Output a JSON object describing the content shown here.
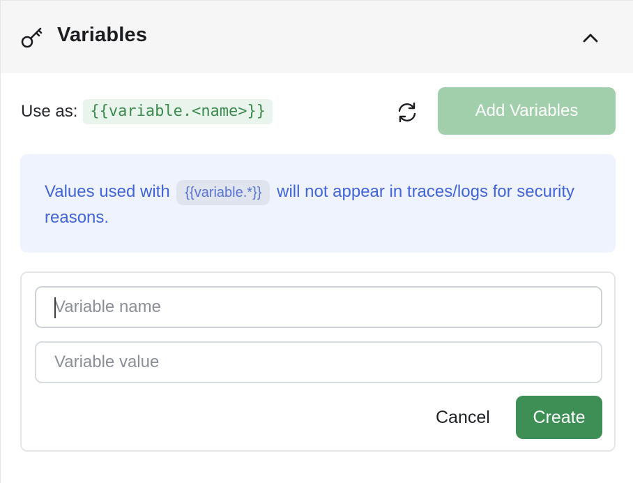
{
  "header": {
    "title": "Variables",
    "icon": "key-icon",
    "toggle_icon": "chevron-up-icon"
  },
  "usage": {
    "label": "Use as:",
    "syntax": "{{variable.<name>}}"
  },
  "toolbar": {
    "refresh_icon": "refresh-icon",
    "add_label": "Add Variables"
  },
  "info": {
    "text_before": "Values used with",
    "chip": "{{variable.*}}",
    "text_after": "will not appear in traces/logs for security reasons."
  },
  "form": {
    "name_placeholder": "Variable name",
    "name_value": "",
    "value_placeholder": "Variable value",
    "value_value": "",
    "cancel_label": "Cancel",
    "create_label": "Create"
  },
  "colors": {
    "accent_green": "#3d8f55",
    "disabled_green": "#a1cfac",
    "info_blue": "#4264d8",
    "info_bg": "#eff3fd"
  }
}
